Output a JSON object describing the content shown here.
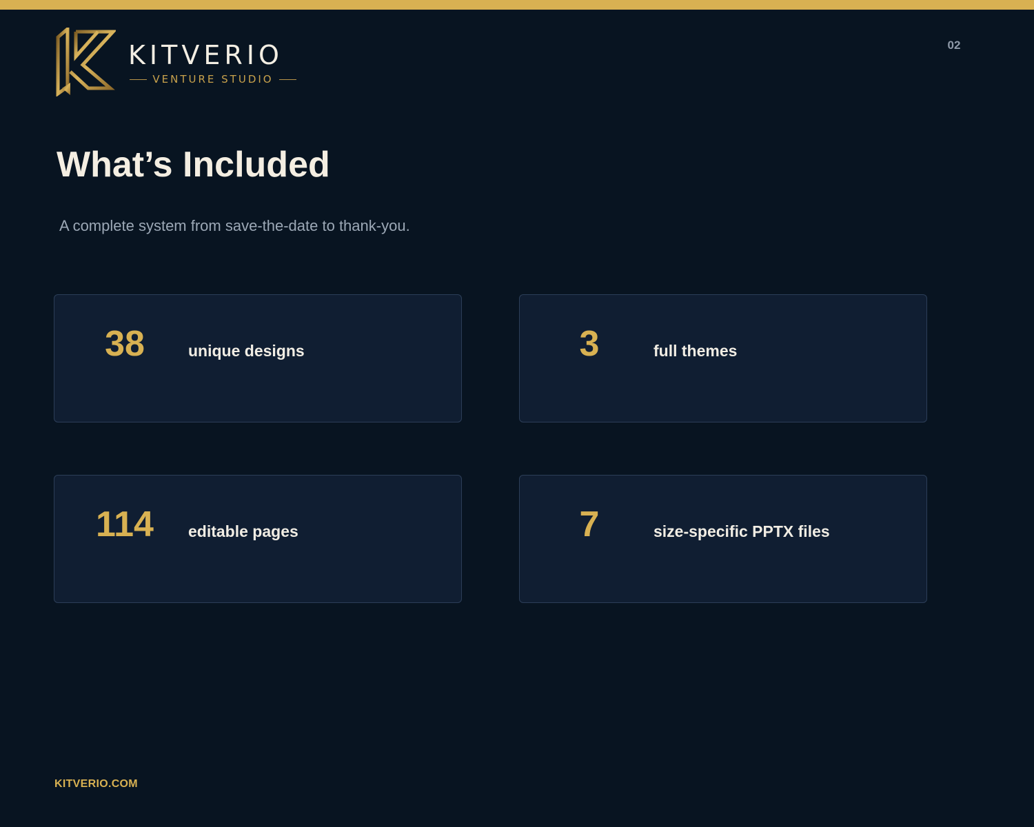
{
  "header": {
    "brand_name": "KITVERIO",
    "brand_tagline": "VENTURE STUDIO",
    "page_number": "02"
  },
  "main": {
    "title": "What’s Included",
    "subtitle": "A complete system from save-the-date to thank-you.",
    "stats": [
      {
        "value": "38",
        "label": "unique designs"
      },
      {
        "value": "3",
        "label": "full themes"
      },
      {
        "value": "114",
        "label": "editable pages"
      },
      {
        "value": "7",
        "label": "size-specific PPTX files"
      }
    ]
  },
  "footer": {
    "website": "KITVERIO.COM"
  },
  "colors": {
    "background": "#081421",
    "accent_gold": "#d8b152",
    "card_background": "#101e32",
    "card_border": "#2c3e58",
    "text_light": "#f4eee2",
    "text_muted": "#9ca8b6"
  }
}
